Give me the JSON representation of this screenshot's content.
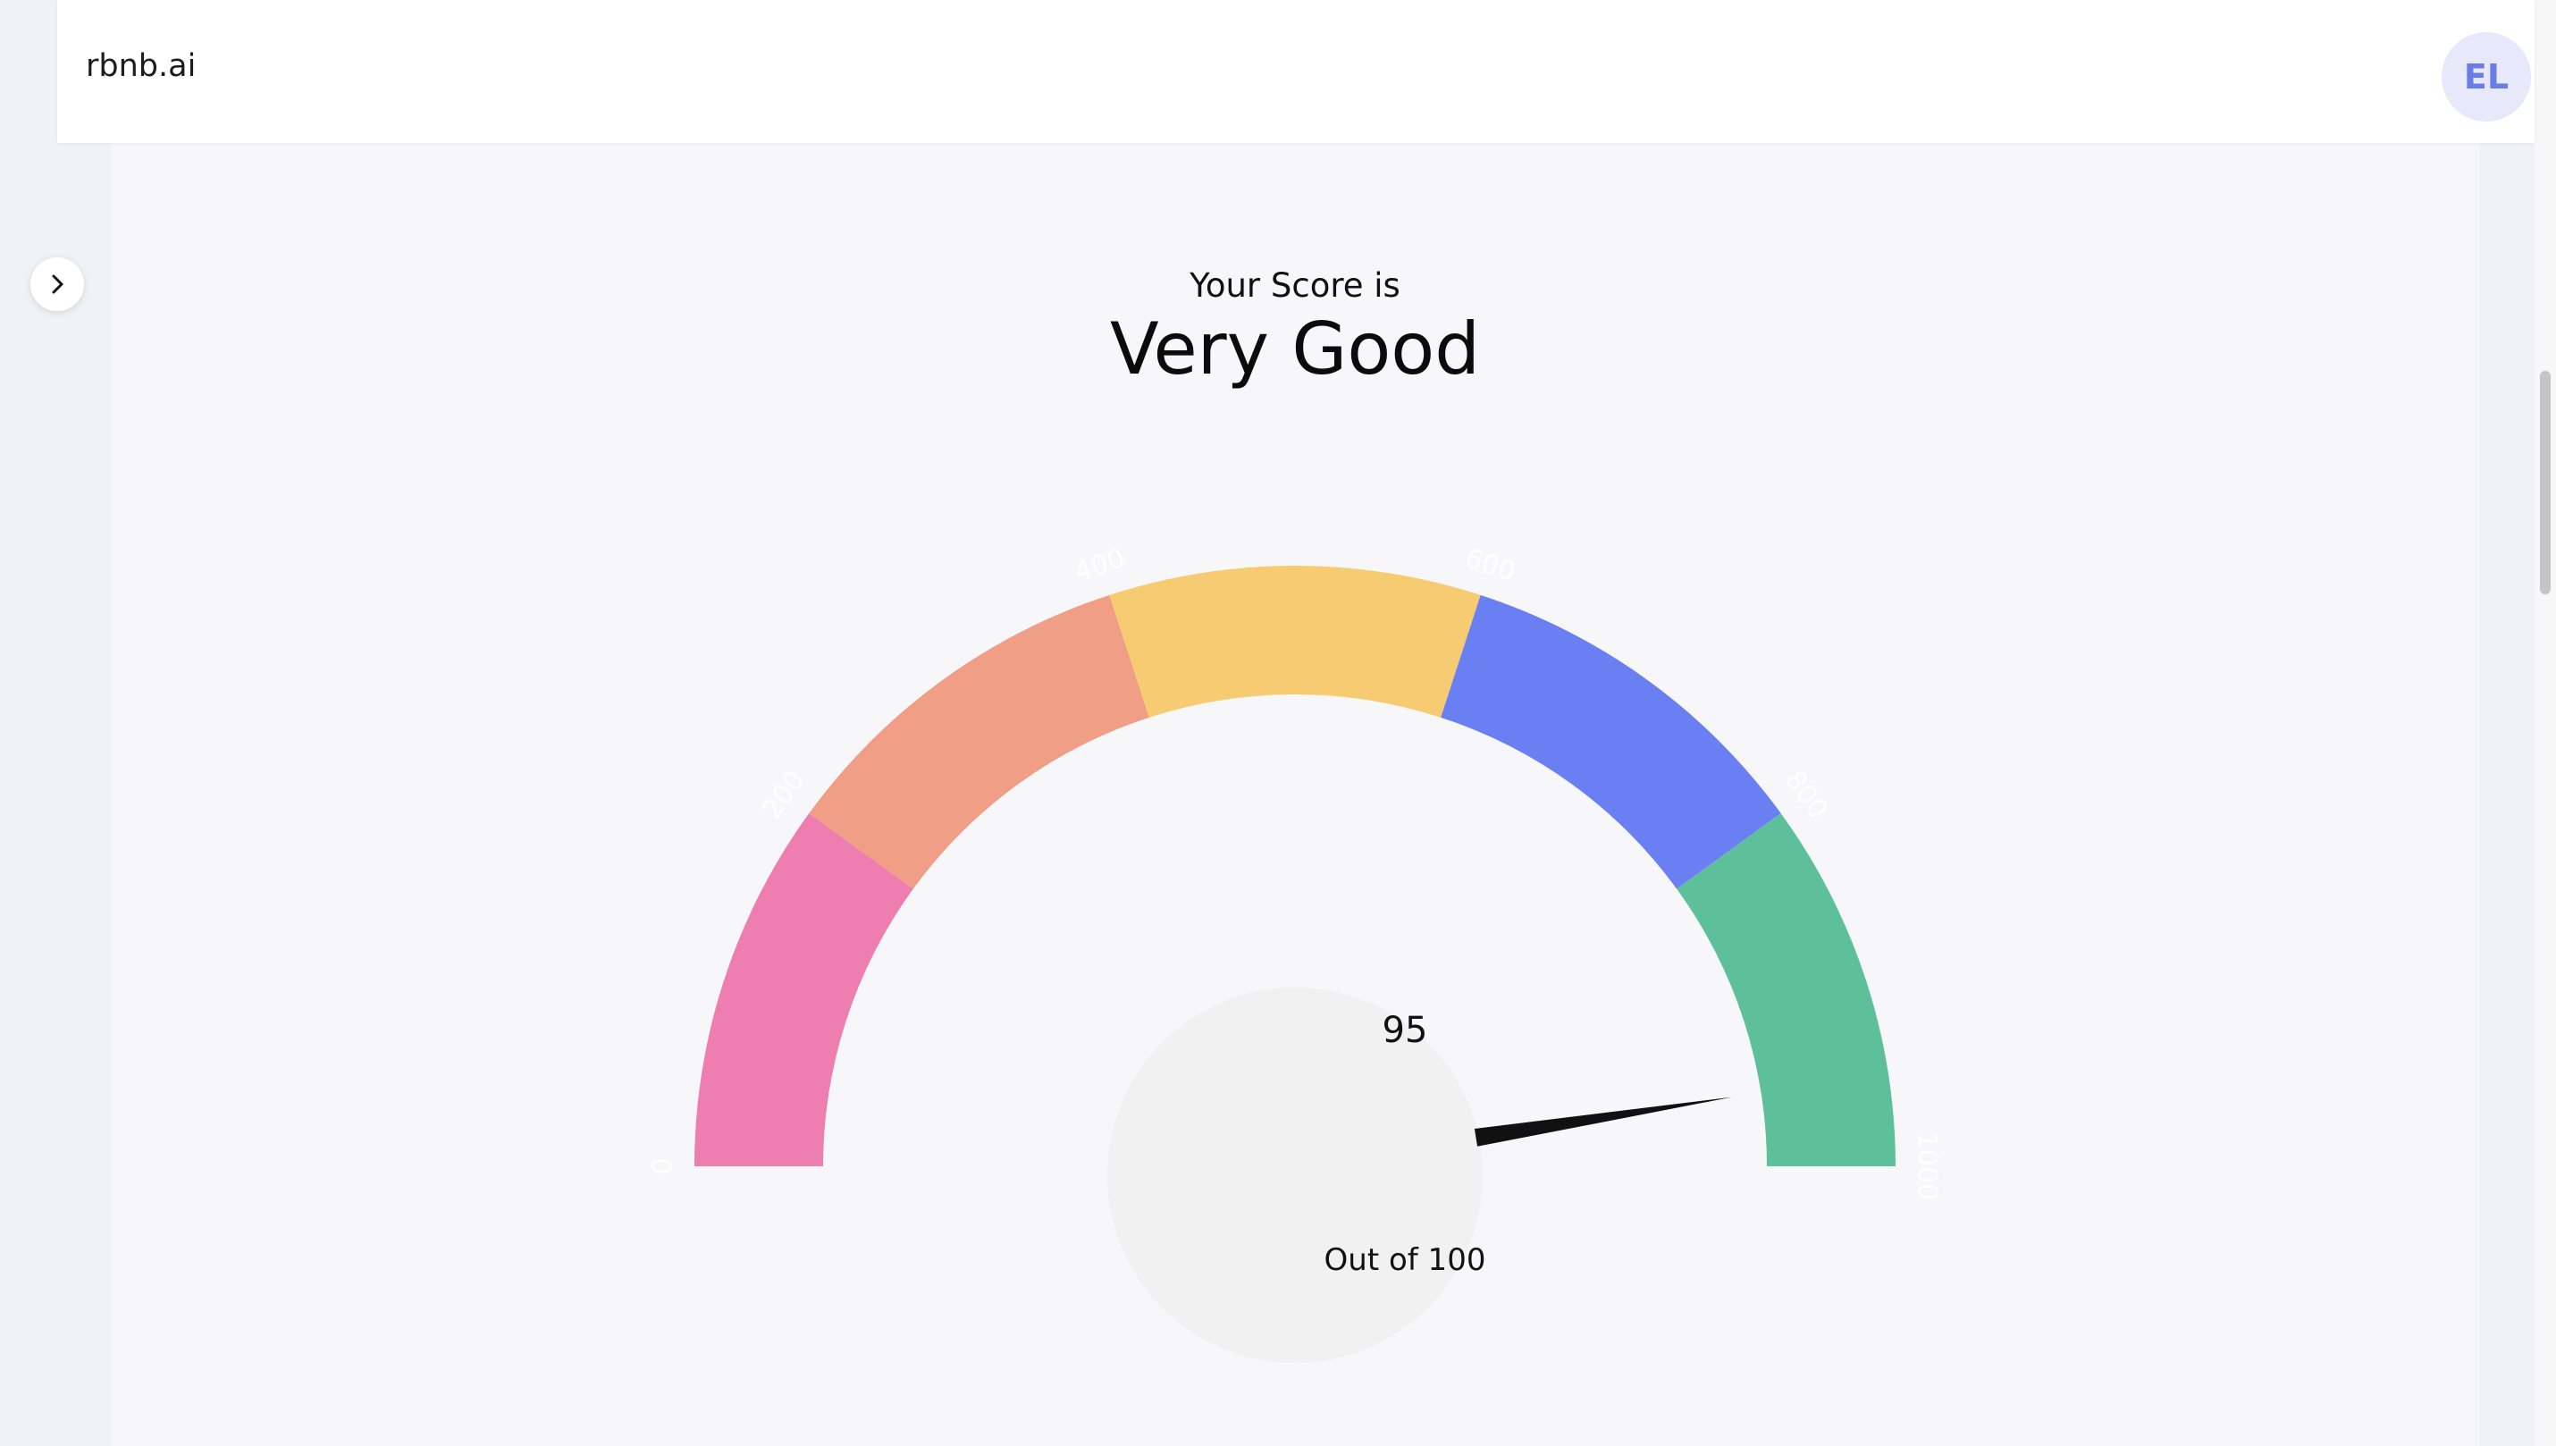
{
  "header": {
    "brand": "rbnb.ai",
    "avatar_initials": "EL"
  },
  "sidebar_toggle": {
    "icon": "chevron-right-icon"
  },
  "score": {
    "intro": "Your Score is",
    "rating": "Very Good"
  },
  "gauge": {
    "value": "95",
    "caption": "Out of 100",
    "min": 0,
    "max": 1000,
    "needle_value": 950,
    "ticks": [
      "0",
      "200",
      "400",
      "600",
      "800",
      "1000"
    ],
    "segments": [
      {
        "from": 0,
        "to": 200,
        "color": "#ee7db0"
      },
      {
        "from": 200,
        "to": 400,
        "color": "#f09e85"
      },
      {
        "from": 400,
        "to": 600,
        "color": "#f7cb71"
      },
      {
        "from": 600,
        "to": 800,
        "color": "#6a80f2"
      },
      {
        "from": 800,
        "to": 1000,
        "color": "#5ec09b"
      }
    ]
  }
}
